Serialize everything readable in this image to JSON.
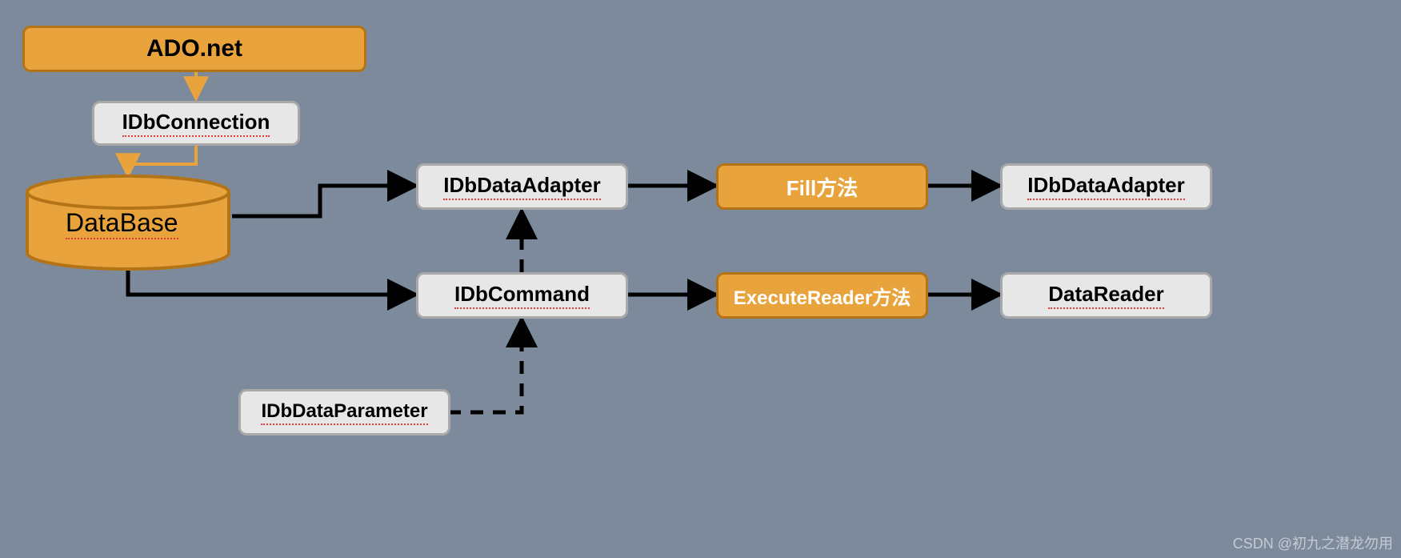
{
  "nodes": {
    "ado": "ADO.net",
    "idbconnection": "IDbConnection",
    "database": "DataBase",
    "idbdataadapter1": "IDbDataAdapter",
    "fill": "Fill方法",
    "idbdataadapter2": "IDbDataAdapter",
    "idbcommand": "IDbCommand",
    "executereader": "ExecuteReader方法",
    "datareader": "DataReader",
    "idbdataparameter": "IDbDataParameter"
  },
  "watermark": "CSDN @初九之潜龙勿用",
  "colors": {
    "orange_fill": "#e8a33d",
    "orange_stroke": "#b37417",
    "grey_fill": "#e7e7e7",
    "grey_stroke": "#a9a9a9",
    "bg": "#7c8a9c"
  }
}
